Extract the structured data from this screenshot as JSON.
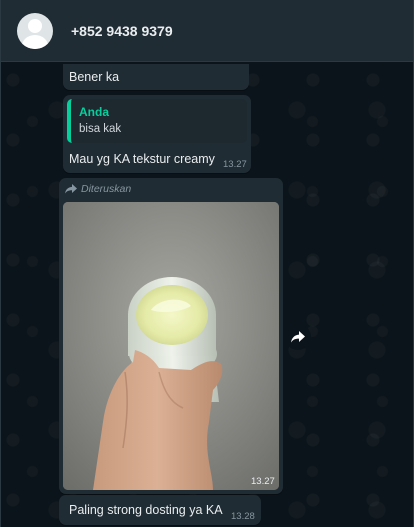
{
  "header": {
    "contact_name": "+852 9438 9379"
  },
  "messages": {
    "m1": {
      "text": "Bener ka"
    },
    "m2": {
      "quote_author": "Anda",
      "quote_text": "bisa kak",
      "text": "Mau yg KA tekstur creamy",
      "time": "13.27"
    },
    "m3": {
      "forwarded_label": "Diteruskan",
      "time": "13.27"
    },
    "m4": {
      "text": "Paling strong dosting ya KA",
      "time": "13.28"
    }
  },
  "colors": {
    "header_bg": "#202c33",
    "bubble_bg": "#202c33",
    "quote_accent": "#06cf9c",
    "chat_bg": "#0b141a"
  },
  "icons": {
    "forwarded": "forward-arrow-icon",
    "forward_button": "share-arrow-icon"
  }
}
